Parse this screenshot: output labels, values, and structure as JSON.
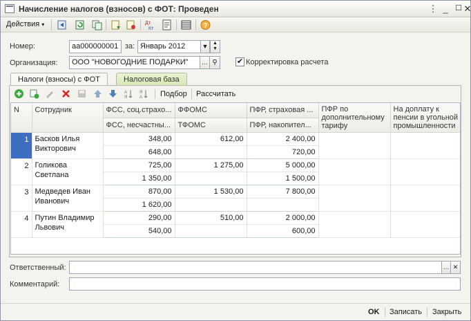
{
  "window": {
    "title": "Начисление налогов (взносов) с ФОТ: Проведен"
  },
  "toolbar": {
    "actions_label": "Действия"
  },
  "header": {
    "number_label": "Номер:",
    "number_value": "аа000000001",
    "period_label": "за:",
    "period_value": "Январь 2012",
    "org_label": "Организация:",
    "org_value": "ООО \"НОВОГОДНИЕ ПОДАРКИ\"",
    "correction_label": "Корректировка расчета",
    "correction_checked": true
  },
  "tabs": [
    {
      "label": "Налоги (взносы) с ФОТ"
    },
    {
      "label": "Налоговая база"
    }
  ],
  "grid_toolbar": {
    "pick_label": "Подбор",
    "calc_label": "Рассчитать"
  },
  "grid": {
    "columns": {
      "n": "N",
      "employee": "Сотрудник",
      "fss_top": "ФСС, соц.страхо...",
      "fss_bottom": "ФСС, несчастны...",
      "ffoms": "ФФОМС",
      "tfoms": "ТФОМС",
      "pfr_top": "ПФР, страховая ...",
      "pfr_bottom": "ПФР, накопител...",
      "pfr_add": "ПФР по дополнительному тарифу",
      "coal": "На доплату к пенсии в угольной промышленности"
    },
    "rows": [
      {
        "n": "1",
        "employee": "Басков Илья Викторович",
        "fss": "348,00",
        "fss_acc": "648,00",
        "ffoms": "612,00",
        "tfoms": "",
        "pfr_ins": "2 400,00",
        "pfr_acc": "720,00"
      },
      {
        "n": "2",
        "employee": "Голикова Светлана",
        "fss": "725,00",
        "fss_acc": "1 350,00",
        "ffoms": "1 275,00",
        "tfoms": "",
        "pfr_ins": "5 000,00",
        "pfr_acc": "1 500,00"
      },
      {
        "n": "3",
        "employee": "Медведев Иван Иванович",
        "fss": "870,00",
        "fss_acc": "1 620,00",
        "ffoms": "1 530,00",
        "tfoms": "",
        "pfr_ins": "7 800,00",
        "pfr_acc": ""
      },
      {
        "n": "4",
        "employee": "Путин Владимир Львович",
        "fss": "290,00",
        "fss_acc": "540,00",
        "ffoms": "510,00",
        "tfoms": "",
        "pfr_ins": "2 000,00",
        "pfr_acc": "600,00"
      }
    ]
  },
  "footer": {
    "responsible_label": "Ответственный:",
    "responsible_value": "",
    "comment_label": "Комментарий:",
    "comment_value": ""
  },
  "statusbar": {
    "ok_label": "OK",
    "save_label": "Записать",
    "close_label": "Закрыть"
  },
  "colors": {
    "selection": "#3d6ec1",
    "active_tab": "#f9f8f4",
    "inactive_tab": "#d7e8b4"
  }
}
